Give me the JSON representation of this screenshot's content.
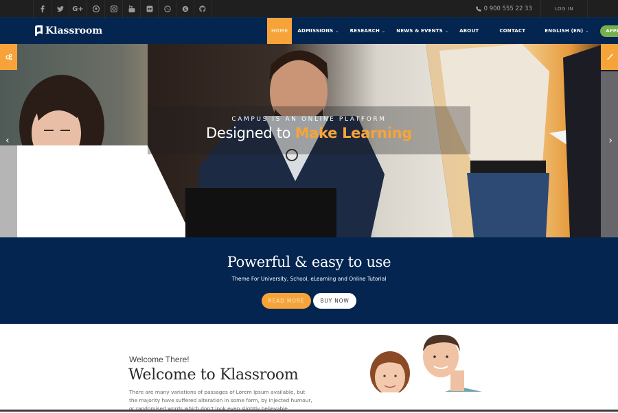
{
  "topbar": {
    "social_icons": [
      {
        "name": "facebook-icon",
        "glyph": "f"
      },
      {
        "name": "twitter-icon",
        "glyph": "t"
      },
      {
        "name": "google-plus-icon",
        "glyph": "G+"
      },
      {
        "name": "pinterest-icon",
        "glyph": "p"
      },
      {
        "name": "instagram-icon",
        "glyph": "ig"
      },
      {
        "name": "youtube-icon",
        "glyph": "yt"
      },
      {
        "name": "flickr-icon",
        "glyph": "fl"
      },
      {
        "name": "whatsapp-icon",
        "glyph": "wa"
      },
      {
        "name": "skype-icon",
        "glyph": "s"
      },
      {
        "name": "github-icon",
        "glyph": "gh"
      }
    ],
    "phone": "0 900 555 22 33",
    "login": "LOG IN"
  },
  "nav": {
    "logo_text": "Klassroom",
    "items": [
      {
        "label": "HOME",
        "active": true,
        "dropdown": false
      },
      {
        "label": "ADMISSIONS",
        "active": false,
        "dropdown": true
      },
      {
        "label": "RESEARCH",
        "active": false,
        "dropdown": true
      },
      {
        "label": "NEWS & EVENTS",
        "active": false,
        "dropdown": true
      },
      {
        "label": "ABOUT",
        "active": false,
        "dropdown": false
      },
      {
        "label": "CONTACT",
        "active": false,
        "dropdown": false
      },
      {
        "label": "ENGLISH (EN)",
        "active": false,
        "dropdown": true
      }
    ],
    "apply_label": "APPLY NOW"
  },
  "hero": {
    "kicker": "CAMPUS IS AN ONLINE PLATFORM",
    "headline_plain": "Designed to ",
    "headline_highlight": "Make Learning",
    "left_tool_icon": "settings-gears-icon",
    "right_tool_icon": "paint-brush-icon",
    "prev_arrow": "‹",
    "next_arrow": "›"
  },
  "promo": {
    "title": "Powerful & easy to use",
    "subtitle": "Theme For University, School, eLearning and Online Tutorial",
    "read_more": "READ MORE",
    "buy_now": "BUY NOW"
  },
  "welcome": {
    "kicker": "Welcome There!",
    "title": "Welcome to Klassroom",
    "body": "There are many variations of passages of Lorem Ipsum available, but the majority have suffered alteration in some form, by injected humour, or randomised words which don't look even slightly believable."
  },
  "colors": {
    "accent_orange": "#f6a43a",
    "navy": "#032550",
    "apply_green": "#76b04d",
    "topbar": "#1f1f1f"
  }
}
